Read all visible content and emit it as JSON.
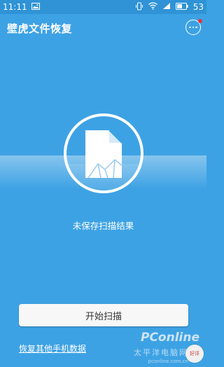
{
  "status_bar": {
    "time": "11:11",
    "battery": "53",
    "icons": [
      "image-icon",
      "vibrate-icon",
      "wifi-icon",
      "signal-icon",
      "battery-icon"
    ]
  },
  "app_bar": {
    "title": "壁虎文件恢复",
    "more_icon": "more-icon"
  },
  "scan": {
    "message": "未保存扫描结果",
    "icon": "document-icon"
  },
  "actions": {
    "start_label": "开始扫描",
    "recover_label": "恢复其他手机数据"
  },
  "watermark": {
    "brand": "PConline",
    "sub": "太平洋电脑网",
    "url": "pconline.com.cn",
    "badge": "好评"
  },
  "colors": {
    "background": "#3da2e4",
    "status_bar": "#2f93d6",
    "notification_dot": "#e8323c",
    "button_bg": "#f7f7f7"
  }
}
